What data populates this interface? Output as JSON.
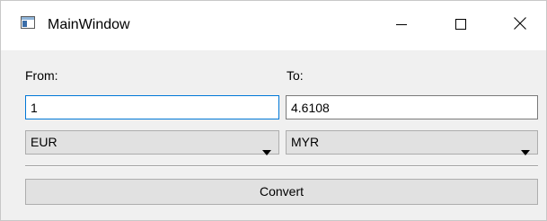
{
  "window": {
    "title": "MainWindow",
    "icon": "app-window-icon"
  },
  "caption_buttons": {
    "minimize_icon": "minimize-icon",
    "maximize_icon": "maximize-icon",
    "close_icon": "close-icon"
  },
  "form": {
    "from_label": "From:",
    "to_label": "To:",
    "from_value": "1",
    "to_value": "4.6108",
    "from_currency": "EUR",
    "to_currency": "MYR",
    "convert_label": "Convert"
  },
  "colors": {
    "focus_border": "#0078d7",
    "window_bg": "#f0f0f0",
    "button_bg": "#e1e1e1"
  }
}
